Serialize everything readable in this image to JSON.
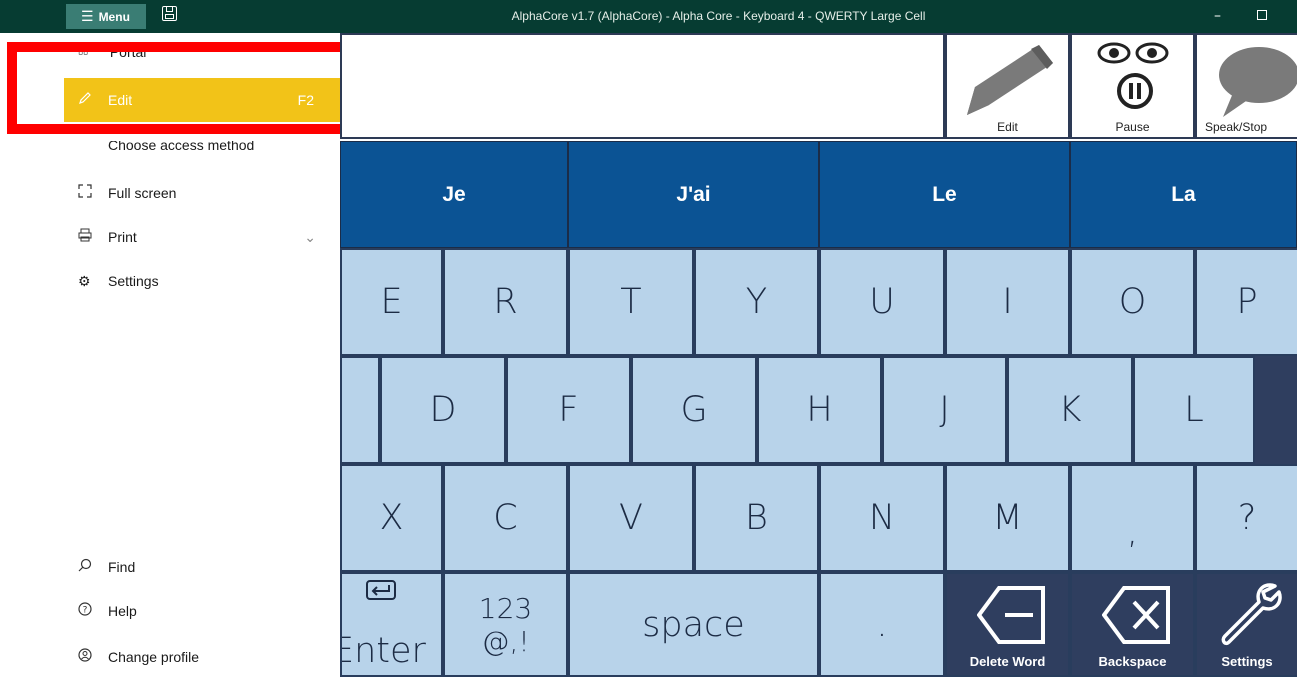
{
  "titlebar": {
    "menu_label": "Menu",
    "title": "AlphaCore v1.7 (AlphaCore) - Alpha Core - Keyboard 4 - QWERTY Large Cell"
  },
  "sidebar": {
    "partial_top": "Portal",
    "partial_mid": "Choose access method",
    "items": [
      {
        "label": "Edit",
        "shortcut": "F2",
        "icon": "pencil-icon",
        "selected": true
      },
      {
        "label": "Full screen",
        "icon": "fullscreen-icon"
      },
      {
        "label": "Print",
        "icon": "printer-icon"
      },
      {
        "label": "Settings",
        "icon": "gear-icon"
      }
    ],
    "bottom": [
      {
        "label": "Find",
        "icon": "search-icon"
      },
      {
        "label": "Help",
        "icon": "help-icon"
      },
      {
        "label": "Change profile",
        "icon": "profile-icon"
      }
    ]
  },
  "toolbar": {
    "edit_label": "Edit",
    "pause_label": "Pause",
    "speak_label": "Speak/Stop"
  },
  "predictions": [
    "Je",
    "J'ai",
    "Le",
    "La"
  ],
  "rows": {
    "row1": [
      "E",
      "R",
      "T",
      "Y",
      "U",
      "I",
      "O",
      "P"
    ],
    "row2": [
      "D",
      "F",
      "G",
      "H",
      "J",
      "K",
      "L"
    ],
    "row3": [
      "X",
      "C",
      "V",
      "B",
      "N",
      "M",
      ",",
      "?"
    ]
  },
  "bottom_row": {
    "enter": "Enter",
    "numbers_top": "123",
    "numbers_bottom": "@,!",
    "space": "space",
    "period": ".",
    "delete_word": "Delete Word",
    "backspace": "Backspace",
    "settings": "Settings"
  },
  "colors": {
    "titlebar": "#063c32",
    "menu_button": "#3a7d74",
    "selected_item": "#f2c318",
    "prediction": "#0b5394",
    "key": "#b8d3ea",
    "action_key": "#2f3e5f",
    "highlight_box": "#ff0000"
  }
}
